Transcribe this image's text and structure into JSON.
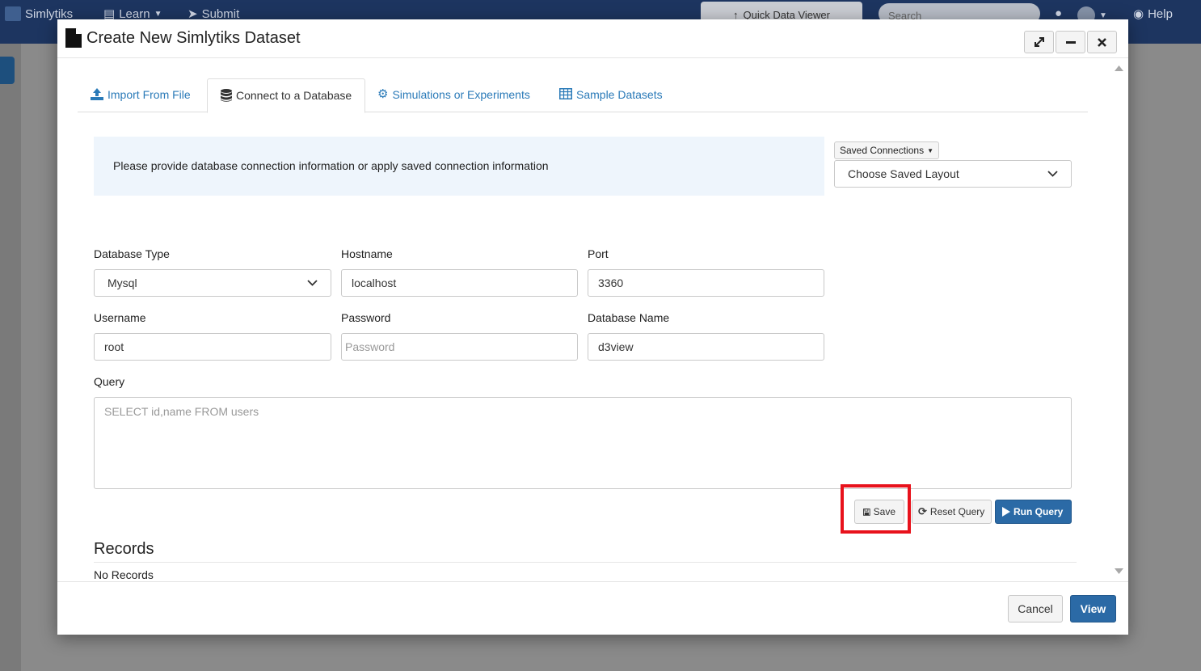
{
  "app": {
    "brand": "Simlytiks",
    "nav": {
      "learn": "Learn",
      "submit": "Submit",
      "quick_data_viewer": "Quick Data Viewer",
      "search_placeholder": "Search",
      "help": "Help"
    }
  },
  "modal": {
    "title": "Create New Simlytiks Dataset",
    "tabs": [
      {
        "label": "Import From File",
        "active": false
      },
      {
        "label": "Connect to a Database",
        "active": true
      },
      {
        "label": "Simulations or Experiments",
        "active": false
      },
      {
        "label": "Sample Datasets",
        "active": false
      }
    ],
    "info_text": "Please provide database connection information or apply saved connection information",
    "saved_connections": {
      "label": "Saved Connections",
      "selected": "Choose Saved Layout"
    },
    "form": {
      "database_type": {
        "label": "Database Type",
        "value": "Mysql"
      },
      "hostname": {
        "label": "Hostname",
        "value": "localhost"
      },
      "port": {
        "label": "Port",
        "value": "3360"
      },
      "username": {
        "label": "Username",
        "value": "root"
      },
      "password": {
        "label": "Password",
        "value": "",
        "placeholder": "Password"
      },
      "database_name": {
        "label": "Database Name",
        "value": "d3view"
      },
      "query": {
        "label": "Query",
        "value": "",
        "placeholder": "SELECT id,name FROM users"
      }
    },
    "actions": {
      "save": "Save",
      "reset_query": "Reset Query",
      "run_query": "Run Query"
    },
    "records": {
      "title": "Records",
      "empty_text": "No Records"
    },
    "footer": {
      "cancel": "Cancel",
      "view": "View"
    },
    "colors": {
      "primary": "#2b6aa6",
      "link": "#2a7ab8",
      "highlight": "#e8121c",
      "info_bg": "#eef5fc"
    }
  }
}
